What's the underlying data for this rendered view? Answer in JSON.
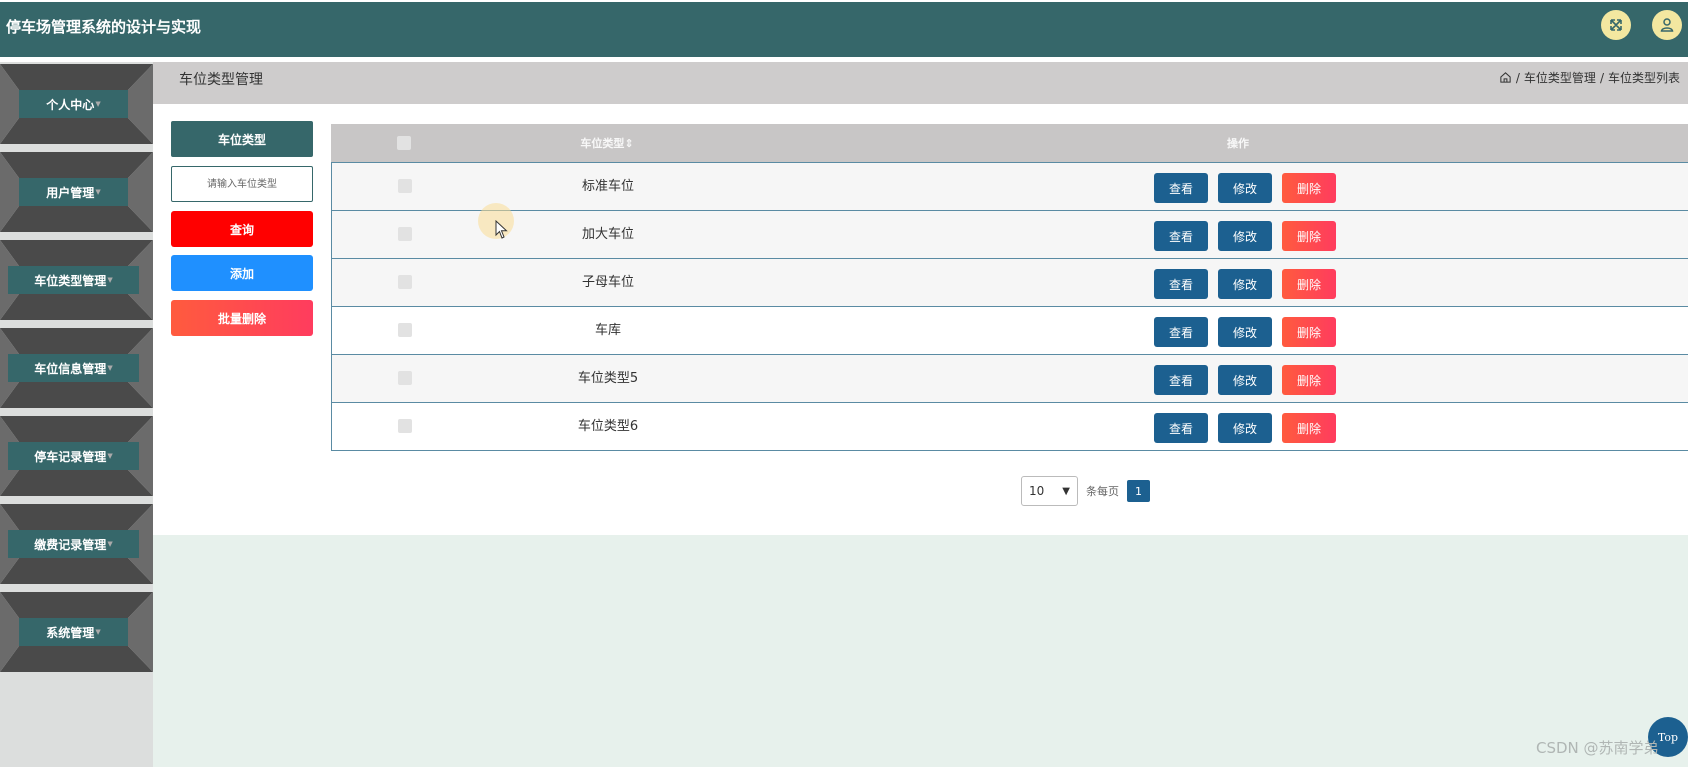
{
  "header": {
    "title": "停车场管理系统的设计与实现",
    "expand_icon": "expand-icon",
    "user_icon": "user-icon",
    "color": "#36676a"
  },
  "sidebar": {
    "items": [
      {
        "label": "个人中心"
      },
      {
        "label": "用户管理"
      },
      {
        "label": "车位类型管理"
      },
      {
        "label": "车位信息管理"
      },
      {
        "label": "停车记录管理"
      },
      {
        "label": "缴费记录管理"
      },
      {
        "label": "系统管理"
      }
    ]
  },
  "page": {
    "title": "车位类型管理",
    "breadcrumb": [
      "车位类型管理",
      "车位类型列表"
    ],
    "breadcrumb_sep": "/"
  },
  "filter": {
    "label": "车位类型",
    "placeholder": "请输入车位类型",
    "query_label": "查询",
    "add_label": "添加",
    "batch_delete_label": "批量删除"
  },
  "table": {
    "columns": {
      "type": "车位类型⇕",
      "actions": "操作"
    },
    "rows": [
      {
        "name": "标准车位"
      },
      {
        "name": "加大车位"
      },
      {
        "name": "子母车位"
      },
      {
        "name": "车库"
      },
      {
        "name": "车位类型5"
      },
      {
        "name": "车位类型6"
      }
    ],
    "actions": {
      "view": "查看",
      "edit": "修改",
      "delete": "删除"
    }
  },
  "pagination": {
    "page_size": "10",
    "per_page_label": "条每页",
    "current_page": "1"
  },
  "misc": {
    "top_label": "Top",
    "watermark": "CSDN @苏南学弟"
  }
}
